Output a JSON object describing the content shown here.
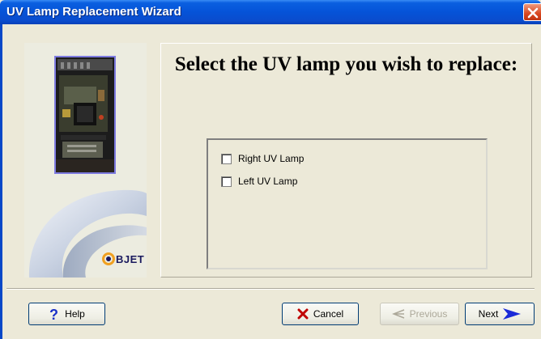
{
  "window": {
    "title": "UV Lamp Replacement Wizard"
  },
  "main": {
    "heading": "Select the UV lamp you wish to replace:",
    "options": [
      {
        "label": "Right UV Lamp",
        "checked": false
      },
      {
        "label": "Left UV Lamp",
        "checked": false
      }
    ]
  },
  "side_panel": {
    "logo_text": "BJET"
  },
  "buttons": {
    "help": "Help",
    "cancel": "Cancel",
    "previous": "Previous",
    "next": "Next"
  },
  "colors": {
    "titlebar": "#0553d8",
    "window_bg": "#ece9d8",
    "cancel_icon": "#c00000",
    "next_arrow": "#1a2ad8",
    "help_icon": "#1a30c8"
  }
}
